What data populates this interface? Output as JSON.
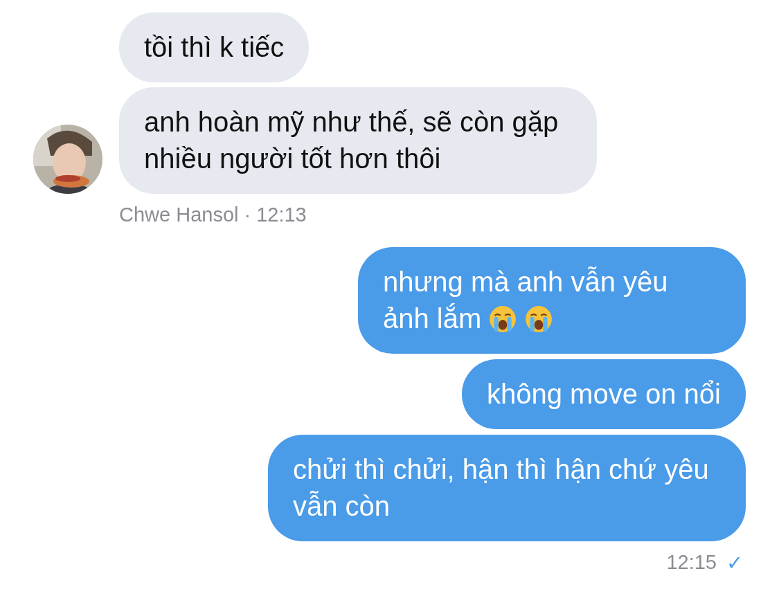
{
  "incoming": {
    "messages": [
      {
        "text": "tồi thì k tiếc"
      },
      {
        "text": "anh hoàn mỹ như thế, sẽ còn gặp nhiều người tốt hơn thôi"
      }
    ],
    "sender": "Chwe Hansol",
    "separator": "·",
    "time": "12:13"
  },
  "outgoing": {
    "messages": [
      {
        "text": "nhưng mà anh vẫn yêu ảnh lắm",
        "icons": [
          {
            "kind": "crying-face"
          },
          {
            "kind": "crying-face"
          }
        ]
      },
      {
        "text": "không move on nổi"
      },
      {
        "text": "chửi thì chửi, hận thì hận chứ yêu vẫn còn"
      }
    ],
    "time": "12:15",
    "status": "✓"
  }
}
